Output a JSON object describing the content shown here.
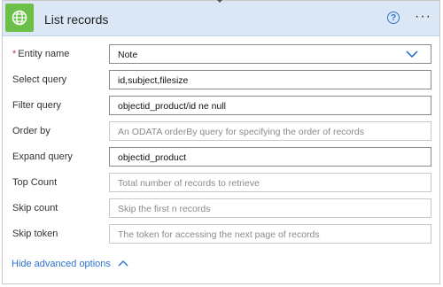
{
  "header": {
    "title": "List records",
    "app_icon": "globe-icon",
    "help_glyph": "?",
    "more_glyph": "···",
    "icon_bg": "#6cc04a"
  },
  "fields": [
    {
      "label": "Entity name",
      "required": "*",
      "value": "Note",
      "type": "dropdown"
    },
    {
      "label": "Select query",
      "value": "id,subject,filesize"
    },
    {
      "label": "Filter query",
      "value": "objectid_product/id ne null"
    },
    {
      "label": "Order by",
      "placeholder": "An ODATA orderBy query for specifying the order of records"
    },
    {
      "label": "Expand query",
      "value": "objectid_product"
    },
    {
      "label": "Top Count",
      "placeholder": "Total number of records to retrieve"
    },
    {
      "label": "Skip count",
      "placeholder": "Skip the first n records"
    },
    {
      "label": "Skip token",
      "placeholder": "The token for accessing the next page of records"
    }
  ],
  "footer": {
    "link_label": "Hide advanced options",
    "link_color": "#2b74d1"
  }
}
